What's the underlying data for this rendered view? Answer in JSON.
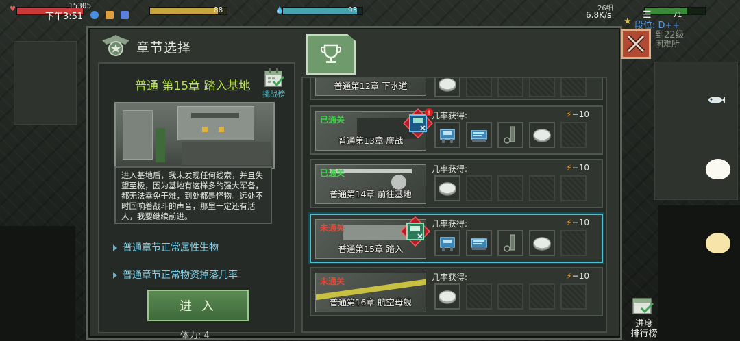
{
  "status_bar": {
    "time": "下午3:51",
    "hp_value": "15305",
    "bar1_value": "88",
    "bar2_value": "93",
    "network": "6.8K/s",
    "battery": "71",
    "right_top_value": "26细",
    "rank_text": "段位: D++",
    "level_text": "到22级",
    "difficulty_text": "困难所"
  },
  "panel": {
    "title": "章节选择",
    "close_label": "关闭"
  },
  "detail": {
    "chapter_title": "普通 第15章  踏入基地",
    "challenge_label": "挑战榜",
    "description": "进入基地后，我未发现任何线索，并且失望至极，因为基地有这样多的强大军备，都无法幸免于难，到处都是怪物。远处不时回响着战斗的声音，那里一定还有活人，我要继续前进。",
    "link_creatures": "普通章节正常属性生物",
    "link_drops": "普通章节正常物资掉落几率",
    "enter_label": "进 入",
    "stamina": "体力: 4"
  },
  "chapters": [
    {
      "name": "普通第12章  下水道",
      "status": "",
      "rate_label": "",
      "cost": "",
      "slots": [
        "coin",
        "empty",
        "empty",
        "empty",
        "empty"
      ]
    },
    {
      "name": "普通第13章  鏖战",
      "status": "已通关",
      "rate_label": "几率获得:",
      "cost": "−10",
      "slots": [
        "machine",
        "machine",
        "bottle",
        "coin",
        "empty"
      ]
    },
    {
      "name": "普通第14章  前往基地",
      "status": "已通关",
      "rate_label": "几率获得:",
      "cost": "−10",
      "slots": [
        "coin",
        "empty",
        "empty",
        "empty",
        "empty"
      ]
    },
    {
      "name": "普通第15章  踏入",
      "status": "未通关",
      "rate_label": "几率获得:",
      "cost": "−10",
      "slots": [
        "machine",
        "machine",
        "bottle",
        "coin",
        "empty"
      ]
    },
    {
      "name": "普通第16章  航空母舰",
      "status": "未通关",
      "rate_label": "几率获得:",
      "cost": "−10",
      "slots": [
        "coin",
        "empty",
        "empty",
        "empty",
        "empty"
      ]
    }
  ],
  "side": {
    "rank_line1": "进度",
    "rank_line2": "排行榜"
  },
  "colors": {
    "cleared": "#3fd34a",
    "uncleared": "#e04a3a",
    "selected_border": "#4fc0cf",
    "title_green": "#b8e24f"
  }
}
